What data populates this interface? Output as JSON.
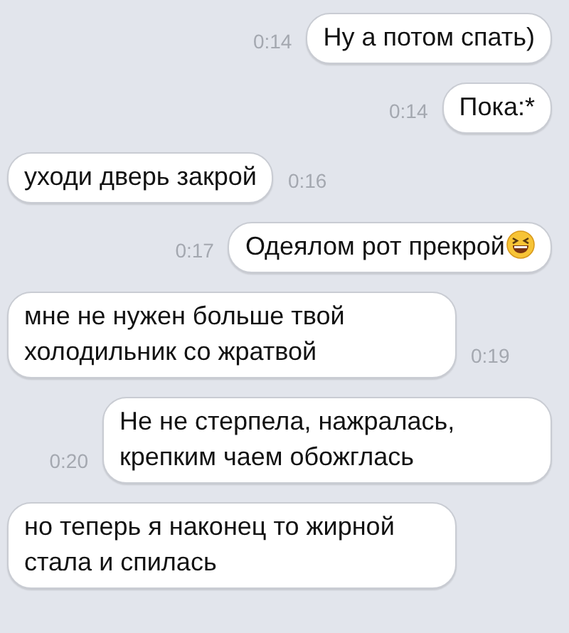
{
  "messages": [
    {
      "kind": "outgoing",
      "text": "Ну а потом спать)",
      "time": "0:14"
    },
    {
      "kind": "outgoing",
      "text": "Пока:*",
      "time": "0:14"
    },
    {
      "kind": "incoming",
      "text": "уходи дверь закрой",
      "time": "0:16"
    },
    {
      "kind": "outgoing",
      "text": "Одеялом рот прекрой",
      "emoji": true,
      "time": "0:17"
    },
    {
      "kind": "incoming",
      "text": "мне не нужен больше твой холодильник со жратвой",
      "time": "0:19"
    },
    {
      "kind": "outgoing",
      "text": "Не не стерпела, нажралась, крепким чаем обожглась",
      "time": "0:20"
    },
    {
      "kind": "incoming",
      "text": "но теперь я наконец то жирной стала и спилась"
    }
  ]
}
